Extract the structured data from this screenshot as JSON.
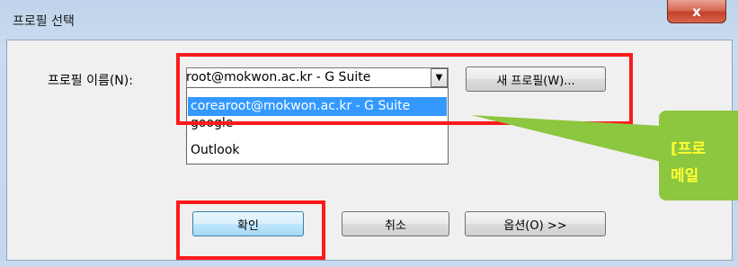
{
  "window": {
    "title": "프로필 선택",
    "close_symbol": "x"
  },
  "form": {
    "profile_label": "프로필 이름(N):",
    "profile_value": "root@mokwon.ac.kr - G Suite",
    "dropdown_arrow": "▼",
    "new_profile_button": "새 프로필(W)...",
    "dropdown_options": [
      "corearoot@mokwon.ac.kr - G Suite",
      "google",
      "Outlook"
    ]
  },
  "buttons": {
    "ok": "확인",
    "cancel": "취소",
    "options": "옵션(O) >>"
  },
  "callout": {
    "line1": "[프로",
    "line2": "메일"
  },
  "colors": {
    "annotation_red": "#ff1a1a",
    "callout_green": "#8dc63f",
    "callout_text": "#ffff33",
    "selection_blue": "#3399ff"
  }
}
